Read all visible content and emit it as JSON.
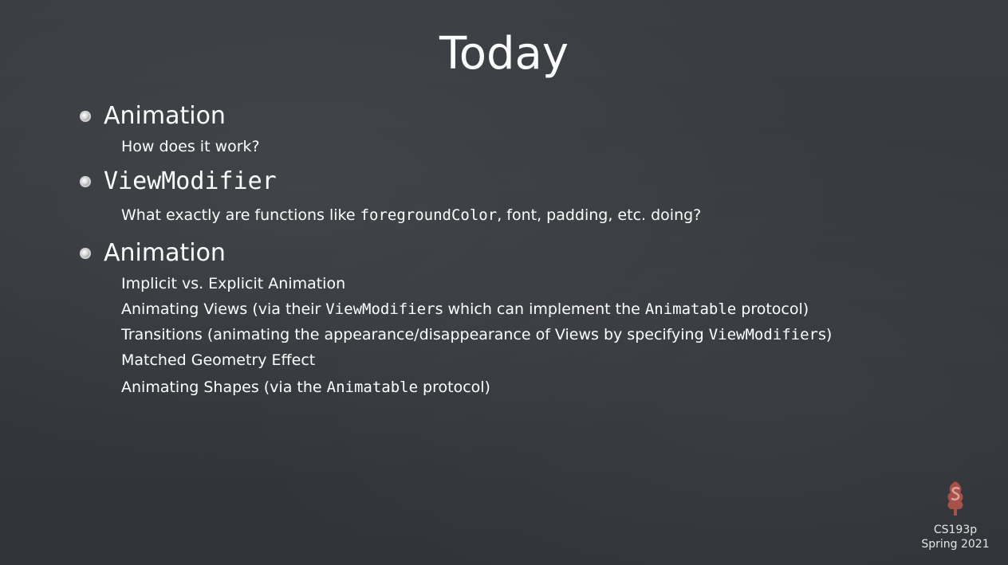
{
  "slide": {
    "title": "Today",
    "sections": [
      {
        "heading": "Animation",
        "items": [
          "How does it work?"
        ]
      },
      {
        "heading": "ViewModifier",
        "items": [
          {
            "before": "What exactly are functions like ",
            "code": "foregroundColor",
            "after": ", font, padding, etc. doing?"
          }
        ]
      },
      {
        "heading": "Animation",
        "items": [
          "Implicit vs. Explicit Animation",
          {
            "before": "Animating Views (via their ",
            "code": "ViewModifier",
            "after_code": "s which can implement the ",
            "code2": "Animatable",
            "after": " protocol)"
          },
          {
            "before": "Transitions (animating the appearance/disappearance of Views by specifying ",
            "code": "ViewModifier",
            "after": "s)"
          },
          "Matched Geometry Effect",
          {
            "before": "Animating Shapes (via the ",
            "code": "Animatable",
            "after": " protocol)"
          }
        ]
      }
    ]
  },
  "footer": {
    "course": "CS193p",
    "term": "Spring 2021",
    "logo_icon": "stanford-tree-logo-icon",
    "logo_color": "#a8504a"
  }
}
